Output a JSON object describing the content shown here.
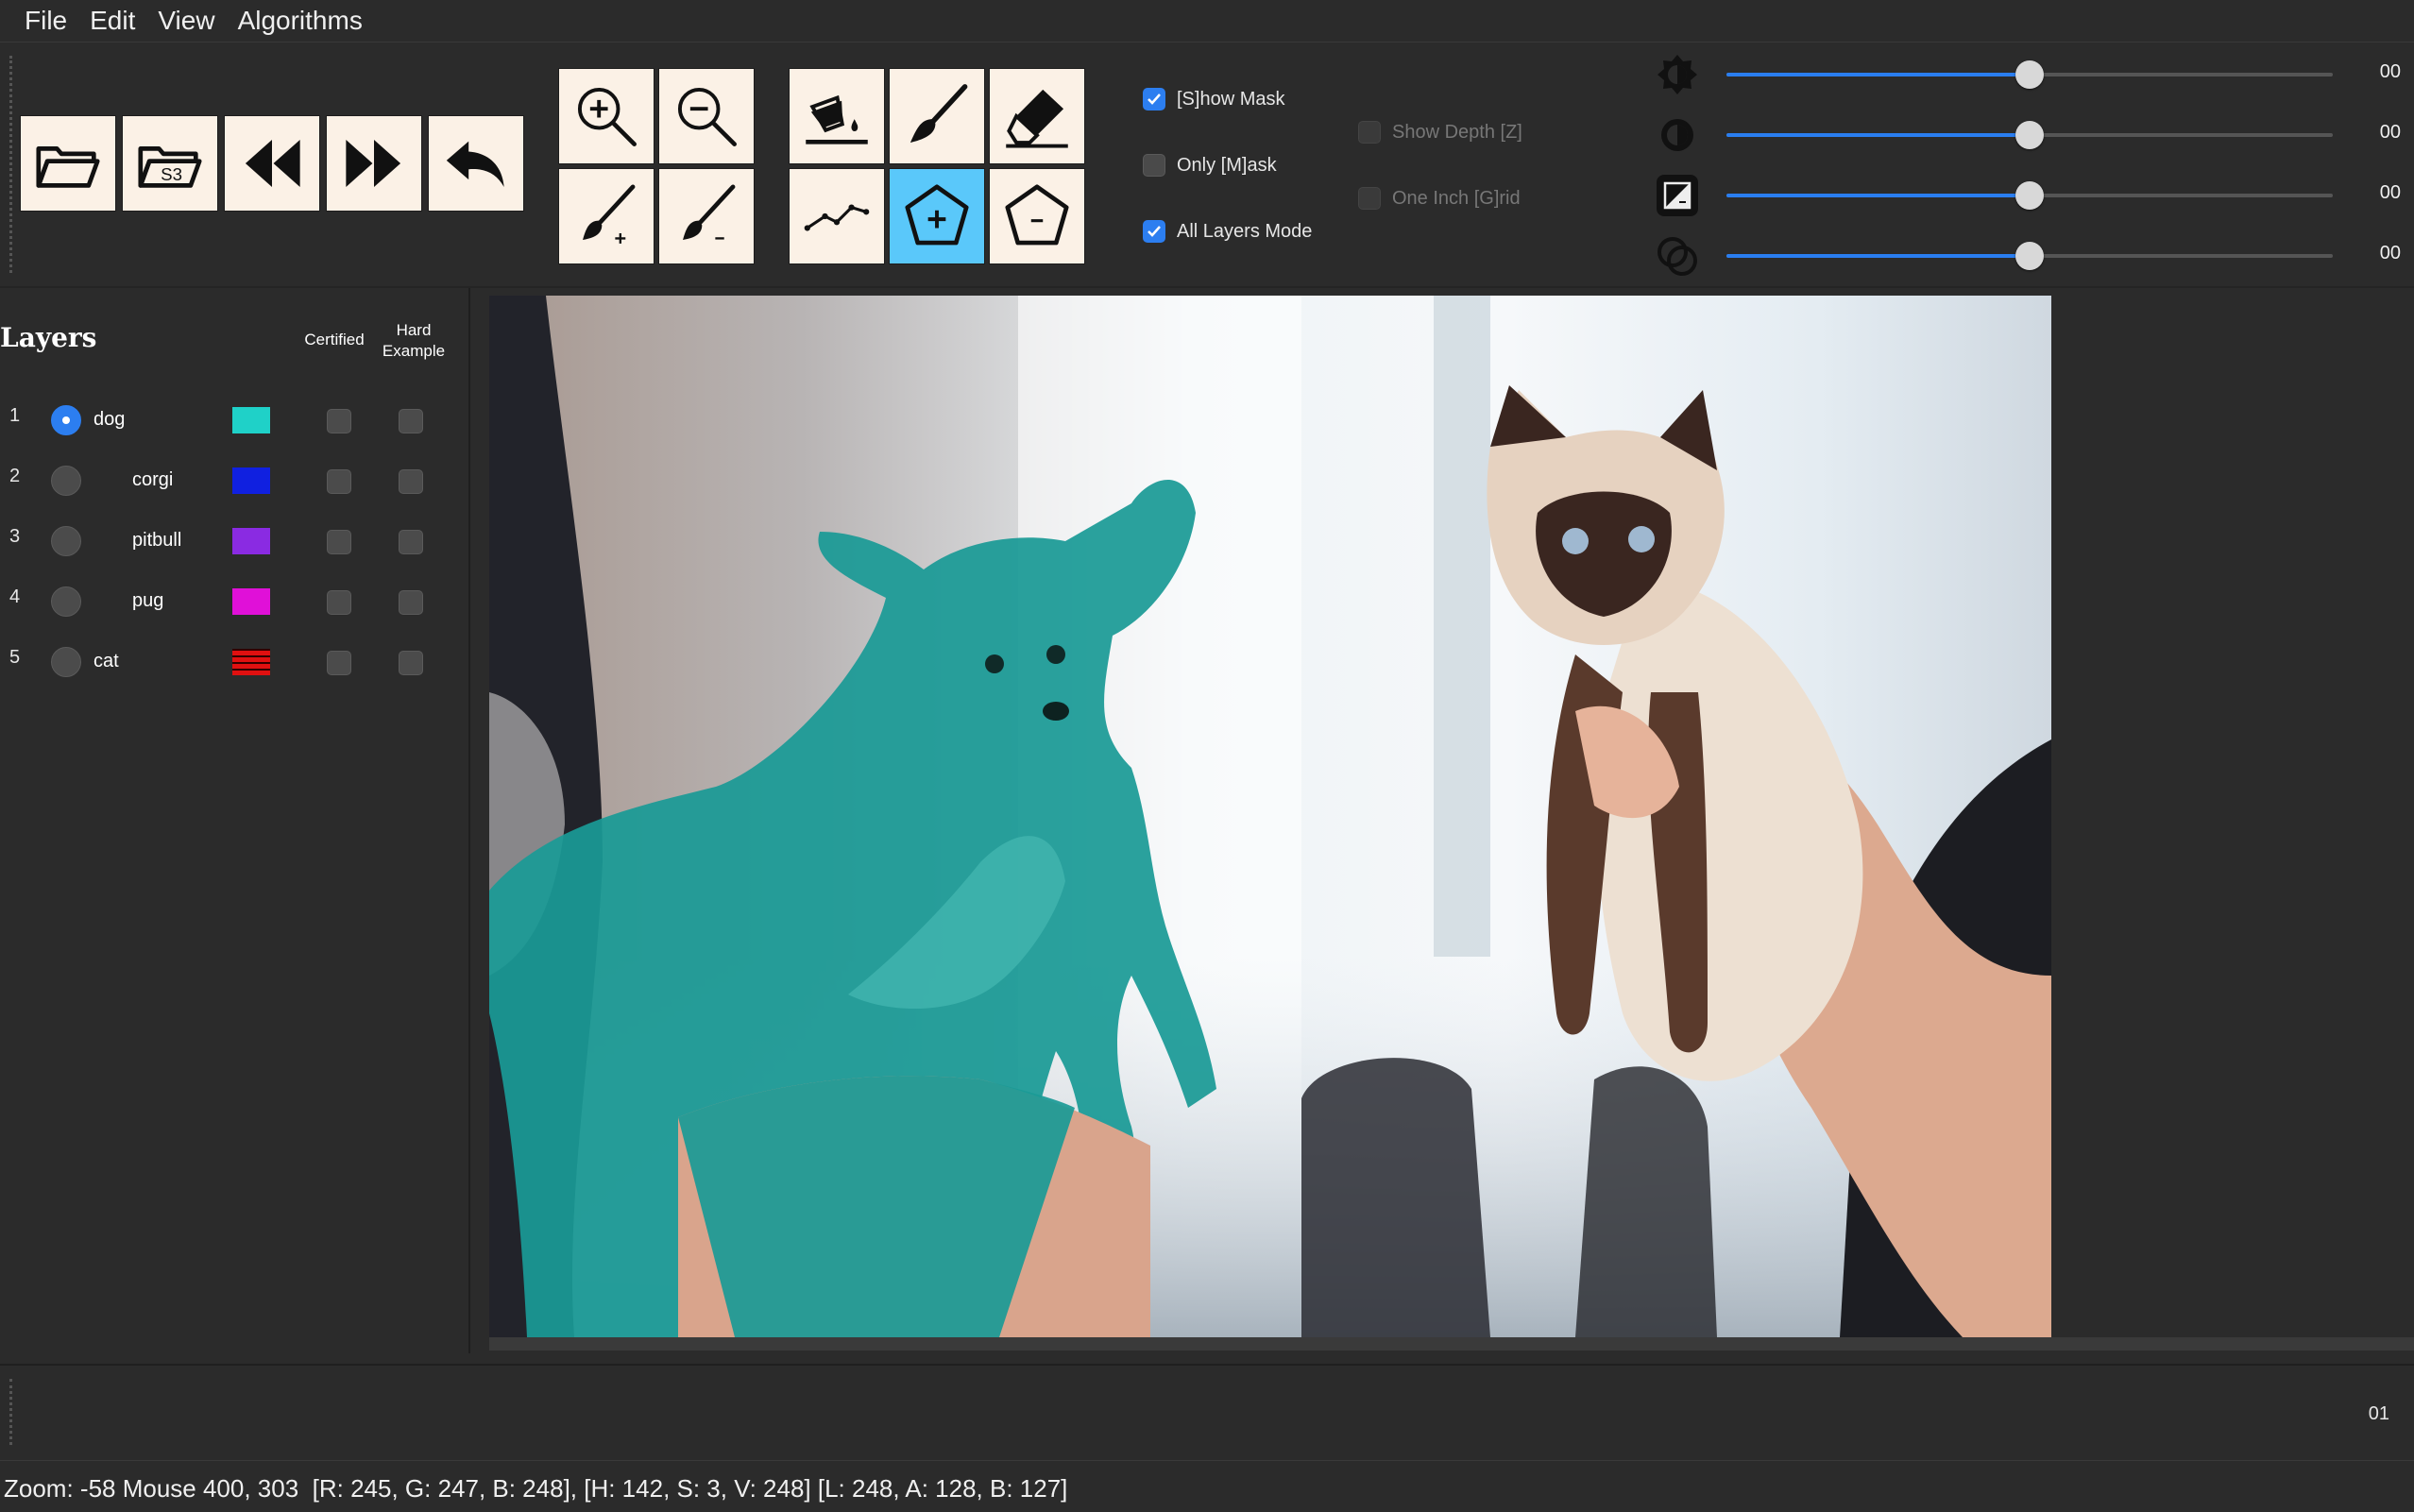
{
  "menu": [
    "File",
    "Edit",
    "View",
    "Algorithms"
  ],
  "toolbar": {
    "file_buttons": [
      "open-folder-icon",
      "open-s3-icon",
      "previous-image-icon",
      "next-image-icon",
      "undo-icon"
    ],
    "s3_label": "S3",
    "zoom_buttons": [
      "zoom-in-icon",
      "zoom-out-icon",
      "brush-add-icon",
      "brush-subtract-icon"
    ],
    "tool_buttons": [
      "fill-bucket-icon",
      "paintbrush-icon",
      "eraser-icon",
      "polyline-icon",
      "polygon-add-icon",
      "polygon-subtract-icon"
    ],
    "active_tool": "polygon-add-icon",
    "checks": [
      {
        "label": "[S]how Mask",
        "checked": true,
        "enabled": true
      },
      {
        "label": "Only [M]ask",
        "checked": false,
        "enabled": true
      },
      {
        "label": "All Layers Mode",
        "checked": true,
        "enabled": true
      },
      {
        "label": "Show Depth [Z]",
        "checked": false,
        "enabled": false
      },
      {
        "label": "One Inch [G]rid",
        "checked": false,
        "enabled": false
      }
    ],
    "sliders": [
      {
        "icon": "brightness-icon",
        "value": "00",
        "level": 0.5
      },
      {
        "icon": "contrast-icon",
        "value": "00",
        "level": 0.5
      },
      {
        "icon": "exposure-icon",
        "value": "00",
        "level": 0.5
      },
      {
        "icon": "overlay-opacity-icon",
        "value": "00",
        "level": 0.5
      }
    ]
  },
  "layers": {
    "title": "Layers",
    "col_certified": "Certified",
    "col_hard_1": "Hard",
    "col_hard_2": "Example",
    "items": [
      {
        "index": "1",
        "name": "dog",
        "color": "#1fd1c8",
        "selected": true
      },
      {
        "index": "2",
        "name": "corgi",
        "color": "#1020e0",
        "selected": false
      },
      {
        "index": "3",
        "name": "pitbull",
        "color": "#8a2be2",
        "selected": false
      },
      {
        "index": "4",
        "name": "pug",
        "color": "#e010d8",
        "selected": false
      },
      {
        "index": "5",
        "name": "cat",
        "color": "#e01010",
        "selected": false
      }
    ]
  },
  "dock": {
    "value": "01"
  },
  "status": "Zoom: -58 Mouse 400, 303  [R: 245, G: 247, B: 248], [H: 142, S: 3, V: 248] [L: 248, A: 128, B: 127]",
  "colors": {
    "accent": "#2c7ef0",
    "active_tool": "#5ac8fa",
    "mask": "#1a9a96"
  }
}
